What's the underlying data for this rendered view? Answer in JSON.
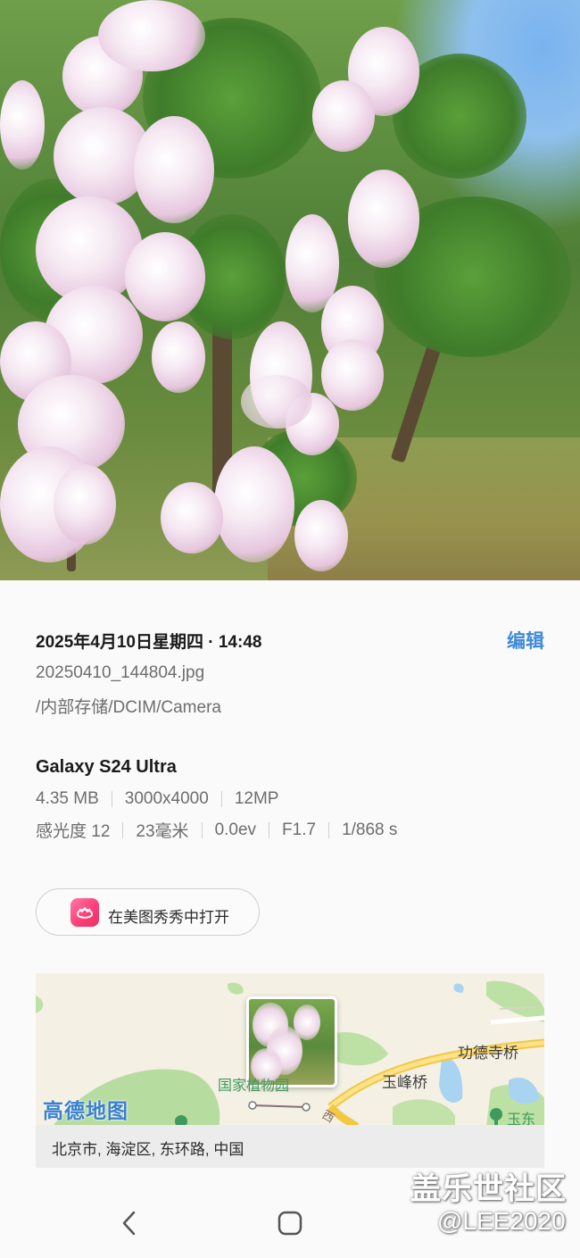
{
  "photo": {
    "description_icon": "photo-preview"
  },
  "details": {
    "datetime": "2025年4月10日星期四 · 14:48",
    "edit_label": "编辑",
    "file_name": "20250410_144804.jpg",
    "file_path": "/内部存储/DCIM/Camera"
  },
  "camera": {
    "device": "Galaxy S24 Ultra",
    "file_size": "4.35 MB",
    "resolution": "3000x4000",
    "megapixels": "12MP",
    "iso": "感光度 12",
    "focal_length": "23毫米",
    "exposure_value": "0.0ev",
    "aperture": "F1.7",
    "shutter": "1/868 s"
  },
  "open_in": {
    "label": "在美图秀秀中打开",
    "icon": "meitu-app-icon",
    "accent": "#ff4f82"
  },
  "map": {
    "logo": "高德地图",
    "labels": {
      "gongde": "功德寺桥",
      "yufeng": "玉峰桥",
      "park": "国家植物园",
      "yudong": "玉东",
      "road": "西"
    },
    "address": "北京市, 海淀区, 东环路, 中国"
  },
  "nav": {
    "back_icon": "back-chevron-icon",
    "home_icon": "home-square-icon"
  },
  "watermark": {
    "line1": "盖乐世社区",
    "line2": "@LEE2020"
  },
  "colors": {
    "accent": "#3f8ad8",
    "secondary_text": "#6d6d6d"
  }
}
